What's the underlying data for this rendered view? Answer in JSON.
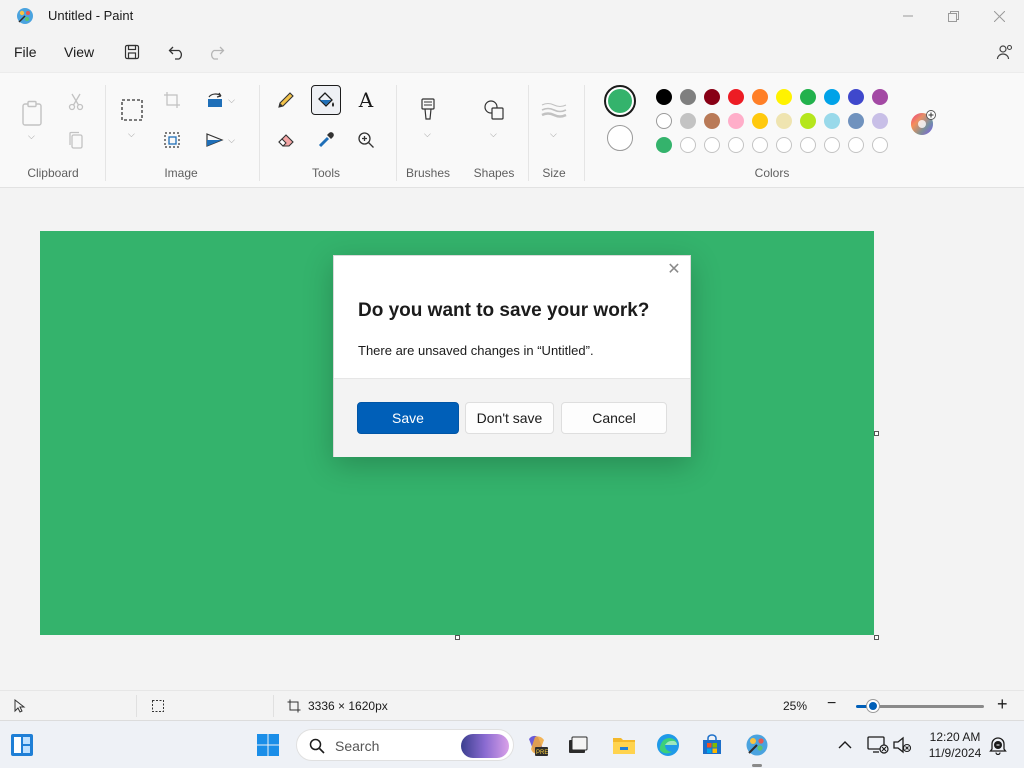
{
  "window": {
    "title": "Untitled - Paint"
  },
  "menu": {
    "file": "File",
    "view": "View"
  },
  "ribbon": {
    "groups": {
      "clipboard": "Clipboard",
      "image": "Image",
      "tools": "Tools",
      "brushes": "Brushes",
      "shapes": "Shapes",
      "size": "Size",
      "colors": "Colors"
    },
    "text_tool_glyph": "A",
    "primary_color": "#34b36c",
    "secondary_color": "#ffffff",
    "palette_row1": [
      "#000000",
      "#7f7f7f",
      "#880015",
      "#ed1c24",
      "#ff7f27",
      "#fff200",
      "#22b14c",
      "#00a2e8",
      "#3f48cc",
      "#a349a4"
    ],
    "palette_row2": [
      "#ffffff",
      "#c3c3c3",
      "#b97a57",
      "#ffaec9",
      "#ffc90e",
      "#efe4b0",
      "#b5e61d",
      "#99d9ea",
      "#7092be",
      "#c8bfe7"
    ],
    "palette_row3": [
      "#34b36c",
      "",
      "",
      "",
      "",
      "",
      "",
      "",
      "",
      ""
    ]
  },
  "canvas": {
    "fill_color": "#34b36c"
  },
  "dialog": {
    "title": "Do you want to save your work?",
    "message": "There are unsaved changes in “Untitled”.",
    "save": "Save",
    "dont_save": "Don't save",
    "cancel": "Cancel",
    "close_glyph": "✕"
  },
  "status": {
    "dimensions": "3336 × 1620px",
    "zoom": "25%",
    "zoom_out": "−",
    "zoom_in": "+",
    "zoom_level_fraction": 0.25
  },
  "taskbar": {
    "search_placeholder": "Search",
    "time": "12:20 AM",
    "date": "11/9/2024"
  }
}
